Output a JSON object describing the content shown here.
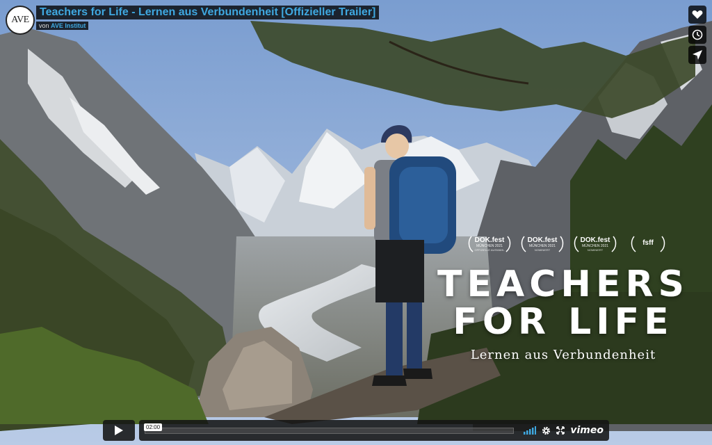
{
  "video": {
    "title": "Teachers for Life - Lernen aus Verbundenheit [Offizieller Trailer]",
    "by_prefix": "von",
    "author": "AVE Institut",
    "channel_logo": "AVE"
  },
  "sidebar_buttons": [
    {
      "name": "like-button",
      "icon": "heart-icon"
    },
    {
      "name": "watch-later-button",
      "icon": "clock-icon"
    },
    {
      "name": "share-button",
      "icon": "paper-plane-icon"
    }
  ],
  "poster": {
    "title_line1": "TEACHERS",
    "title_line2": "FOR LIFE",
    "subtitle": "Lernen aus Verbundenheit",
    "badges": [
      {
        "main": "DOK.fest",
        "sub": "MÜNCHEN 2021",
        "sub2": "OFFIZIELLE AUSWAHL"
      },
      {
        "main": "DOK.fest",
        "sub": "MÜNCHEN 2021",
        "sub2": "NOMINIERT"
      },
      {
        "main": "DOK.fest",
        "sub": "MÜNCHEN 2021",
        "sub2": "NOMINIERT"
      },
      {
        "main": "fsff",
        "sub": "",
        "sub2": ""
      }
    ]
  },
  "player": {
    "duration": "02:00",
    "progress_fraction": 0,
    "brand": "vimeo"
  },
  "colors": {
    "link_blue": "#3fa8e0",
    "sky": "#8fb2de",
    "bar_bg": "#141414"
  }
}
